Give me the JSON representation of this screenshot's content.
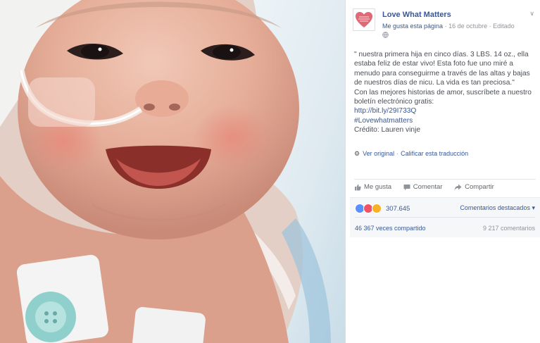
{
  "page": {
    "name": "Love What Matters",
    "like_page": "Me gusta esta página",
    "date": "16 de octubre",
    "edited": "Editado"
  },
  "post": {
    "quote": "\" nuestra primera hija en cinco días. 3 LBS. 14 oz., ella estaba feliz de estar vivo! Esta foto fue uno miré a menudo para conseguirme a través de las altas y bajas de nuestros días de nicu. La vida es tan preciosa.\"",
    "cta": "Con las mejores historias de amor, suscríbete a nuestro boletín electrónico gratis:",
    "link": "http://bit.ly/29I733Q",
    "hashtag": "#Lovewhatmatters",
    "credit": "Crédito: Lauren vinje"
  },
  "meta": {
    "see_original": "Ver original",
    "rate_translation": "Calificar esta traducción"
  },
  "actions": {
    "like": "Me gusta",
    "comment": "Comentar",
    "share": "Compartir"
  },
  "social": {
    "reaction_count": "307.645",
    "featured_comments": "Comentarios destacados",
    "shares": "46 367 veces compartido",
    "comments": "9 217 comentarios"
  },
  "colors": {
    "link": "#365899",
    "like_reaction": "#5890ff",
    "love_reaction": "#f25268",
    "wow_reaction": "#f7b125"
  }
}
